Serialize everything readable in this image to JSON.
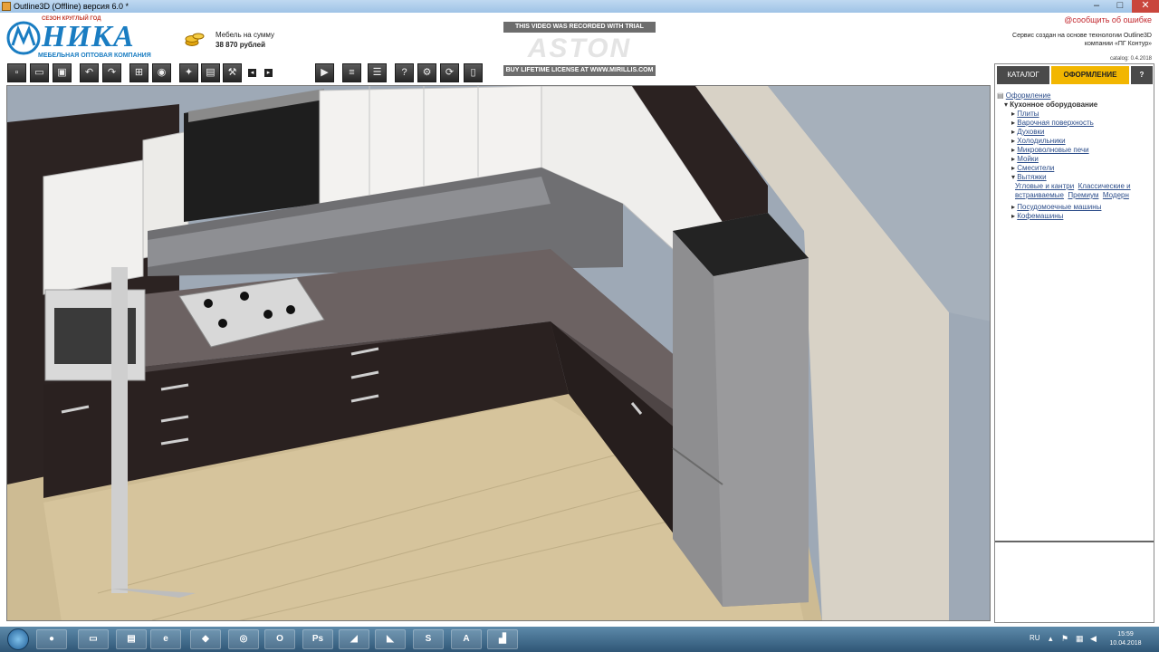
{
  "window": {
    "title": "Outline3D (Offline) версия 6.0 *"
  },
  "header": {
    "logo_tagline": "СЕЗОН КРУГЛЫЙ ГОД",
    "logo_word": "НИКА",
    "logo_sub": "МЕБЕЛЬНАЯ ОПТОВАЯ КОМПАНИЯ",
    "sum_label": "Мебель на сумму",
    "sum_value": "38 870 рублей",
    "report_link": "@сообщить об ошибке",
    "service_note_1": "Сервис создан на основе технологии Outline3D",
    "service_note_2": "компании «ПГ Контур»",
    "catalog_version": "catalog: 0.4.2018"
  },
  "trial": {
    "top": "THIS VIDEO WAS RECORDED WITH TRIAL VERSION",
    "logo": "ASTON",
    "bottom": "BUY LIFETIME LICENSE AT WWW.MIRILLIS.COM"
  },
  "toolbar": {
    "icons": [
      "new-icon",
      "open-icon",
      "save-icon",
      "undo-icon",
      "redo-icon",
      "grid-icon",
      "camera-icon",
      "tool-icon",
      "tool2-icon",
      "wrench-icon",
      "left-icon",
      "right-icon",
      "record-icon",
      "stack-icon",
      "list-icon",
      "help-icon",
      "tools-icon",
      "refresh-icon",
      "page-icon"
    ]
  },
  "panel": {
    "tabs": {
      "catalog": "КАТАЛОГ",
      "design": "ОФОРМЛЕНИЕ",
      "help": "?"
    },
    "tree": {
      "root": "Оформление",
      "group": "Кухонное оборудование",
      "items": [
        "Плиты",
        "Варочная поверхность",
        "Духовки",
        "Холодильники",
        "Микроволновые печи",
        "Мойки",
        "Смесители",
        "Вытяжки"
      ],
      "hood_types": [
        "Угловые и кантри",
        "Классические и встраиваемые",
        "Премиум",
        "Модерн"
      ],
      "after": [
        "Посудомоечные машины",
        "Кофемашины"
      ]
    }
  },
  "taskbar": {
    "lang": "RU",
    "time": "15:59",
    "date": "10.04.2018"
  },
  "colors": {
    "accent": "#f2b600",
    "logo_blue": "#1a7dc2",
    "link_red": "#c2272d"
  }
}
